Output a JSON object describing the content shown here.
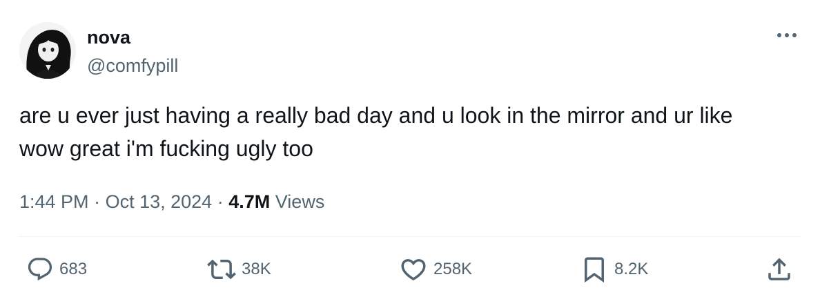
{
  "author": {
    "display_name": "nova",
    "handle": "@comfypill"
  },
  "tweet": {
    "text": "are u ever just having a really bad day and u look in the mirror and ur like\nwow great i'm fucking ugly too"
  },
  "meta": {
    "time": "1:44 PM",
    "separator": "·",
    "date": "Oct 13, 2024",
    "views_count": "4.7M",
    "views_label": "Views"
  },
  "actions": {
    "replies": "683",
    "reposts": "38K",
    "likes": "258K",
    "bookmarks": "8.2K"
  },
  "icons": {
    "reply": "reply-icon",
    "repost": "repost-icon",
    "like": "heart-icon",
    "bookmark": "bookmark-icon",
    "share": "share-icon",
    "more": "more-icon"
  },
  "colors": {
    "text_primary": "#0f1419",
    "text_secondary": "#536471",
    "divider": "#eff3f4"
  }
}
